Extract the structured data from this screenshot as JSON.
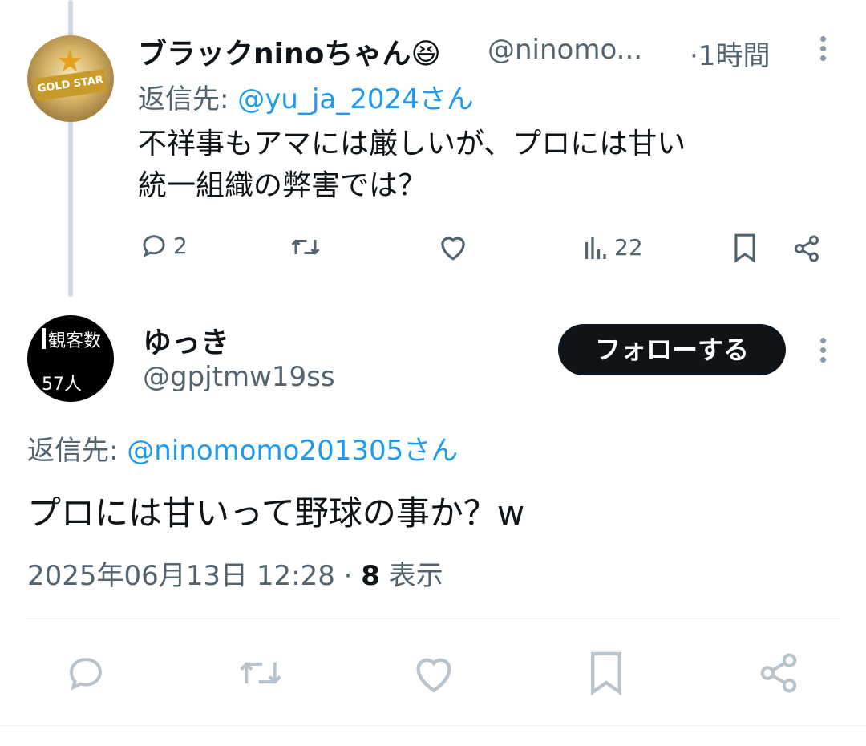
{
  "tweet1": {
    "display_name": "ブラックninoちゃん😆",
    "handle": "@ninomo...",
    "time": "·1時間",
    "reply_prefix": "返信先:",
    "reply_handle": "@yu_ja_2024さん",
    "text_line1": "不祥事もアマには厳しいが、プロには甘い",
    "text_line2": "統一組織の弊害では？",
    "avatar_label": "GOLD STAR",
    "actions": {
      "reply_count": "2",
      "views_count": "22"
    }
  },
  "tweet2": {
    "display_name": "ゆっき",
    "handle": "@gpjtmw19ss",
    "follow_label": "フォローする",
    "avatar_top": "観客数",
    "avatar_bottom": "57人",
    "reply_prefix": "返信先:",
    "reply_handle": "@ninomomo201305さん",
    "text": "プロには甘いって野球の事か？w",
    "timestamp": "2025年06月13日 12:28",
    "separator": "·",
    "views_number": "8",
    "views_label": "表示"
  },
  "colors": {
    "link": "#1d9bf0",
    "muted": "#536471",
    "button_bg": "#0f1419"
  }
}
